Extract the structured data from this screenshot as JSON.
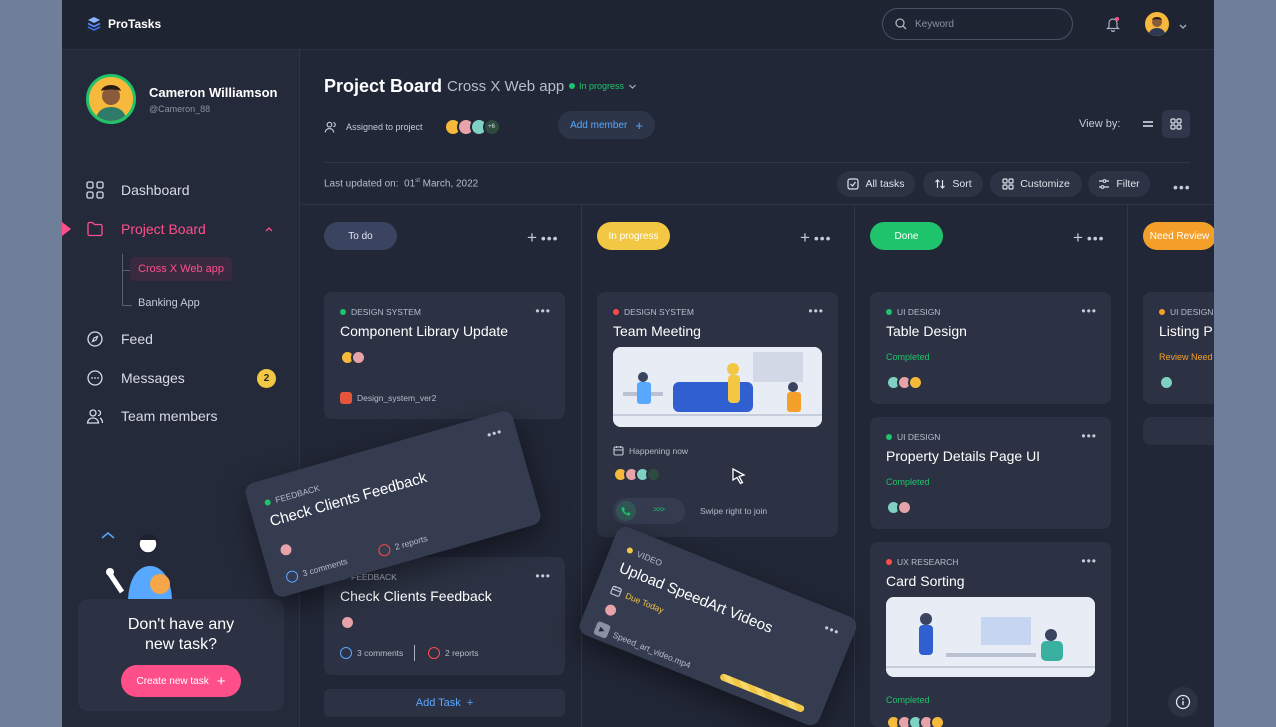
{
  "app": {
    "name": "ProTasks"
  },
  "search": {
    "placeholder": "Keyword"
  },
  "user": {
    "name": "Cameron Williamson",
    "handle": "@Cameron_88"
  },
  "nav": {
    "dashboard": "Dashboard",
    "project_board": "Project Board",
    "sub_items": [
      "Cross X Web app",
      "Banking App"
    ],
    "feed": "Feed",
    "messages": "Messages",
    "messages_badge": "2",
    "team_members": "Team members"
  },
  "promo": {
    "line1": "Don't have any",
    "line2": "new task?",
    "button": "Create new task"
  },
  "header": {
    "title": "Project Board",
    "project": "Cross X Web app",
    "status": "In progress",
    "assigned_label": "Assigned to project",
    "assigned_extra": "+6",
    "add_member": "Add member",
    "view_by": "View by:",
    "updated_prefix": "Last updated on:",
    "updated_day": "01",
    "updated_suffix": "st",
    "updated_rest": "March, 2022"
  },
  "toolbar": {
    "all_tasks": "All tasks",
    "sort": "Sort",
    "customize": "Customize",
    "filter": "Filter"
  },
  "columns": {
    "todo": "To do",
    "inprogress": "In progress",
    "done": "Done",
    "review": "Need Review"
  },
  "cards": {
    "c1": {
      "tag": "DESIGN SYSTEM",
      "title": "Component Library Update",
      "file": "Design_system_ver2"
    },
    "c2": {
      "tag": "FEEDBACK",
      "title": "Check Clients Feedback",
      "comments": "3 comments",
      "reports": "2 reports"
    },
    "c3": {
      "tag": "DESIGN SYSTEM",
      "title": "Team Meeting",
      "happening": "Happening now",
      "swipe": "Swipe right to join"
    },
    "c4": {
      "tag": "UI DESIGN",
      "title": "Table Design",
      "status": "Completed"
    },
    "c5": {
      "tag": "UI DESIGN",
      "title": "Property Details Page UI",
      "status": "Completed"
    },
    "c6": {
      "tag": "UX RESEARCH",
      "title": "Card Sorting",
      "status": "Completed"
    },
    "c7": {
      "tag": "UI DESIGN",
      "title": "Listing P",
      "status": "Review Need"
    },
    "float1": {
      "tag": "FEEDBACK",
      "title": "Check Clients Feedback",
      "comments": "3 comments",
      "reports": "2 reports"
    },
    "float2": {
      "tag": "VIDEO",
      "title": "Upload SpeedArt Videos",
      "due": "Due Today",
      "file": "Speed_art_video.mp4"
    }
  },
  "add_task": "Add Task",
  "colors": {
    "accent": "#ff4f8b",
    "green": "#1fc36b",
    "yellow": "#f2c744",
    "orange": "#f59f2b",
    "blue": "#58a8ff",
    "red": "#ff4a4a"
  }
}
